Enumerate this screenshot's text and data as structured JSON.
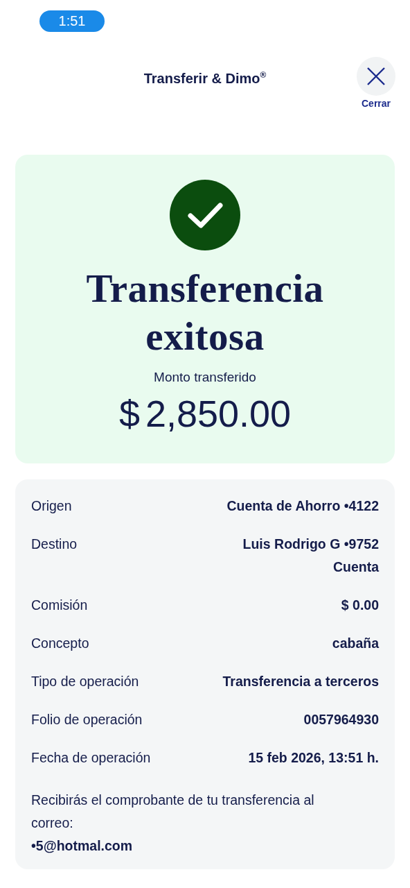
{
  "status_bar": {
    "time": "1:51"
  },
  "header": {
    "title": "Transferir & Dimo$^{®}$",
    "close_label": "Cerrar"
  },
  "result": {
    "title": "Transferencia exitosa",
    "amount_label": "Monto transferido",
    "amount_symbol": "$",
    "amount": "2,850.00"
  },
  "details": [
    {
      "label": "Origen",
      "value": "Cuenta de Ahorro •4122"
    },
    {
      "label": "Destino",
      "value": "Luis Rodrigo G •9752\nCuenta"
    },
    {
      "label": "Comisión",
      "value": "$ 0.00"
    },
    {
      "label": "Concepto",
      "value": "cabaña"
    },
    {
      "label": "Tipo de operación",
      "value": "Transferencia a terceros"
    },
    {
      "label": "Folio de operación",
      "value": "0057964930"
    },
    {
      "label": "Fecha de operación",
      "value": "15 feb 2026, 13:51 h."
    }
  ],
  "note": "Recibirás el comprobante de tu transferencia al correo:",
  "email": "•5@hotmal.com"
}
